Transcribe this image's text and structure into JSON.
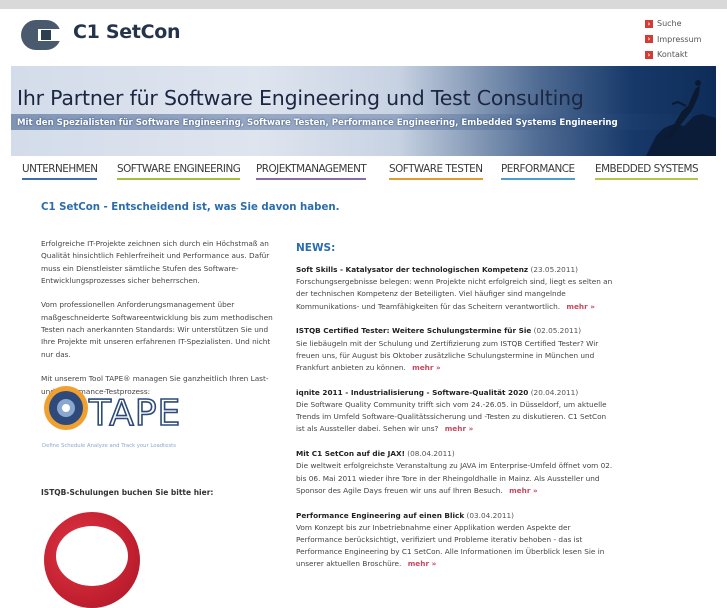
{
  "header": {
    "logo_text": "C1 SetCon",
    "links": [
      {
        "label": "Suche"
      },
      {
        "label": "Impressum"
      },
      {
        "label": "Kontakt"
      }
    ]
  },
  "banner": {
    "title": "Ihr Partner für Software Engineering und Test Consulting",
    "subtitle": "Mit den Spezialisten für Software Engineering, Software Testen, Performance Engineering, Embedded Systems Engineering"
  },
  "nav": {
    "items": [
      {
        "label": "UNTERNEHMEN",
        "color": "#3e6fa8"
      },
      {
        "label": "SOFTWARE ENGINEERING",
        "color": "#9fbf3e"
      },
      {
        "label": "PROJEKTMANAGEMENT",
        "color": "#8a6aa8"
      },
      {
        "label": "SOFTWARE TESTEN",
        "color": "#e39b2f"
      },
      {
        "label": "PERFORMANCE",
        "color": "#4b9fc8"
      },
      {
        "label": "EMBEDDED SYSTEMS",
        "color": "#b6c44a"
      }
    ]
  },
  "main": {
    "headline": "C1 SetCon - Entscheidend ist, was Sie davon haben.",
    "paragraphs": [
      "Erfolgreiche IT-Projekte zeichnen sich durch ein Höchstmaß an Qualität hinsichtlich Fehlerfreiheit und Performance aus. Dafür muss ein Dienstleister sämtliche Stufen des Software-Entwicklungsprozesses sicher beherrschen.",
      "Vom professionellen Anforderungsmanagement über maßgeschneiderte Softwareentwicklung bis zum methodischen Testen nach anerkannten Standards: Wir unterstützen Sie und Ihre Projekte mit unseren erfahrenen IT-Spezialisten. Und nicht nur das.",
      "Mit unserem Tool TAPE® managen Sie ganzheitlich Ihren Last- und Performance-Testprozess:"
    ],
    "tape": {
      "logo_text": "TAPE",
      "tagline": "Define Schedule Analyze and Track your Loadtests"
    },
    "istqb_label": "ISTQB-Schulungen buchen Sie bitte hier:"
  },
  "news": {
    "title": "NEWS:",
    "more_label": "mehr »",
    "items": [
      {
        "title": "Soft Skills - Katalysator der technologischen Kompetenz",
        "date": "(23.05.2011)",
        "text": "Forschungsergebnisse belegen: wenn Projekte nicht erfolgreich sind, liegt es selten an der technischen Kompetenz der Beteiligten. Viel häufiger sind mangelnde Kommunikations- und Teamfähigkeiten für das Scheitern verantwortlich."
      },
      {
        "title": "ISTQB Certified Tester: Weitere Schulungstermine für Sie",
        "date": "(02.05.2011)",
        "text": "Sie liebäugeln mit der Schulung und Zertifizierung zum ISTQB Certified Tester? Wir freuen uns, für August bis Oktober zusätzliche Schulungstermine in München und Frankfurt anbieten zu können."
      },
      {
        "title": "iqnite 2011 - Industrialisierung - Software-Qualität 2020",
        "date": "(20.04.2011)",
        "text": "Die Software Quality Community trifft sich vom 24.-26.05. in Düsseldorf, um aktuelle Trends im Umfeld Software-Qualitätssicherung und -Testen zu diskutieren. C1 SetCon ist als Aussteller dabei. Sehen wir uns?"
      },
      {
        "title": "Mit C1 SetCon auf die JAX!",
        "date": "(08.04.2011)",
        "text": "Die weltweit erfolgreichste Veranstaltung zu JAVA im Enterprise-Umfeld öffnet vom 02. bis 06. Mai 2011 wieder ihre Tore in der Rheingoldhalle in Mainz. Als Aussteller und Sponsor des Agile Days freuen wir uns auf Ihren Besuch."
      },
      {
        "title": "Performance Engineering auf einen Blick",
        "date": "(03.04.2011)",
        "text": "Vom Konzept bis zur Inbetriebnahme einer Applikation werden Aspekte der Performance berücksichtigt, verifiziert und Probleme iterativ behoben - das ist Performance Engineering by C1 SetCon. Alle Informationen im Überblick lesen Sie in unserer aktuellen Broschüre."
      }
    ]
  }
}
